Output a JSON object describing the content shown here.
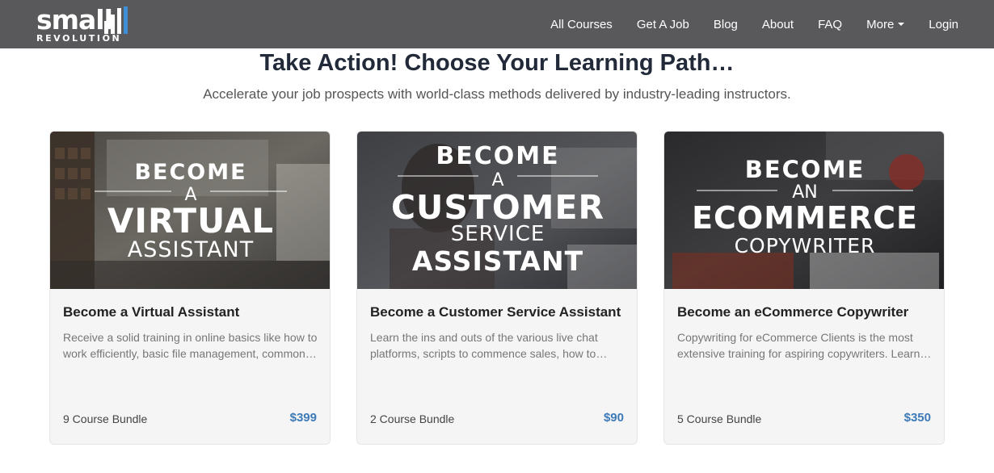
{
  "brand": {
    "logo_main": "small",
    "logo_sub": "REVOLUTION"
  },
  "nav": {
    "items": [
      {
        "label": "All Courses"
      },
      {
        "label": "Get A Job"
      },
      {
        "label": "Blog"
      },
      {
        "label": "About"
      },
      {
        "label": "FAQ"
      },
      {
        "label": "More",
        "has_dropdown": true
      },
      {
        "label": "Login"
      }
    ]
  },
  "header": {
    "title": "Take Action! Choose Your Learning Path…",
    "subtitle": "Accelerate your job prospects with world-class methods delivered by industry-leading instructors."
  },
  "cards": [
    {
      "image_lines": [
        "BECOME",
        "A",
        "VIRTUAL",
        "ASSISTANT"
      ],
      "title": "Become a Virtual Assistant",
      "description": "Receive a solid training in online basics like how to work efficiently, basic file management, common tools and more.",
      "bundle": "9 Course Bundle",
      "price": "$399"
    },
    {
      "image_lines": [
        "BECOME",
        "A",
        "CUSTOMER",
        "SERVICE",
        "ASSISTANT"
      ],
      "title": "Become a Customer Service Assistant",
      "description": "Learn the ins and outs of the various live chat platforms, scripts to commence sales, how to handle customers and more.",
      "bundle": "2 Course Bundle",
      "price": "$90"
    },
    {
      "image_lines": [
        "BECOME",
        "AN",
        "ECOMMERCE",
        "COPYWRITER"
      ],
      "title": "Become an eCommerce Copywriter",
      "description": "Copywriting for eCommerce Clients is the most extensive training for aspiring copywriters. Learn to write product descriptions and more.",
      "bundle": "5 Course Bundle",
      "price": "$350"
    }
  ],
  "colors": {
    "navbar": "#59595b",
    "logo_bar_accent": "#3d8fd6",
    "price": "#3d7ab8",
    "card_bg": "#f5f5f5"
  }
}
